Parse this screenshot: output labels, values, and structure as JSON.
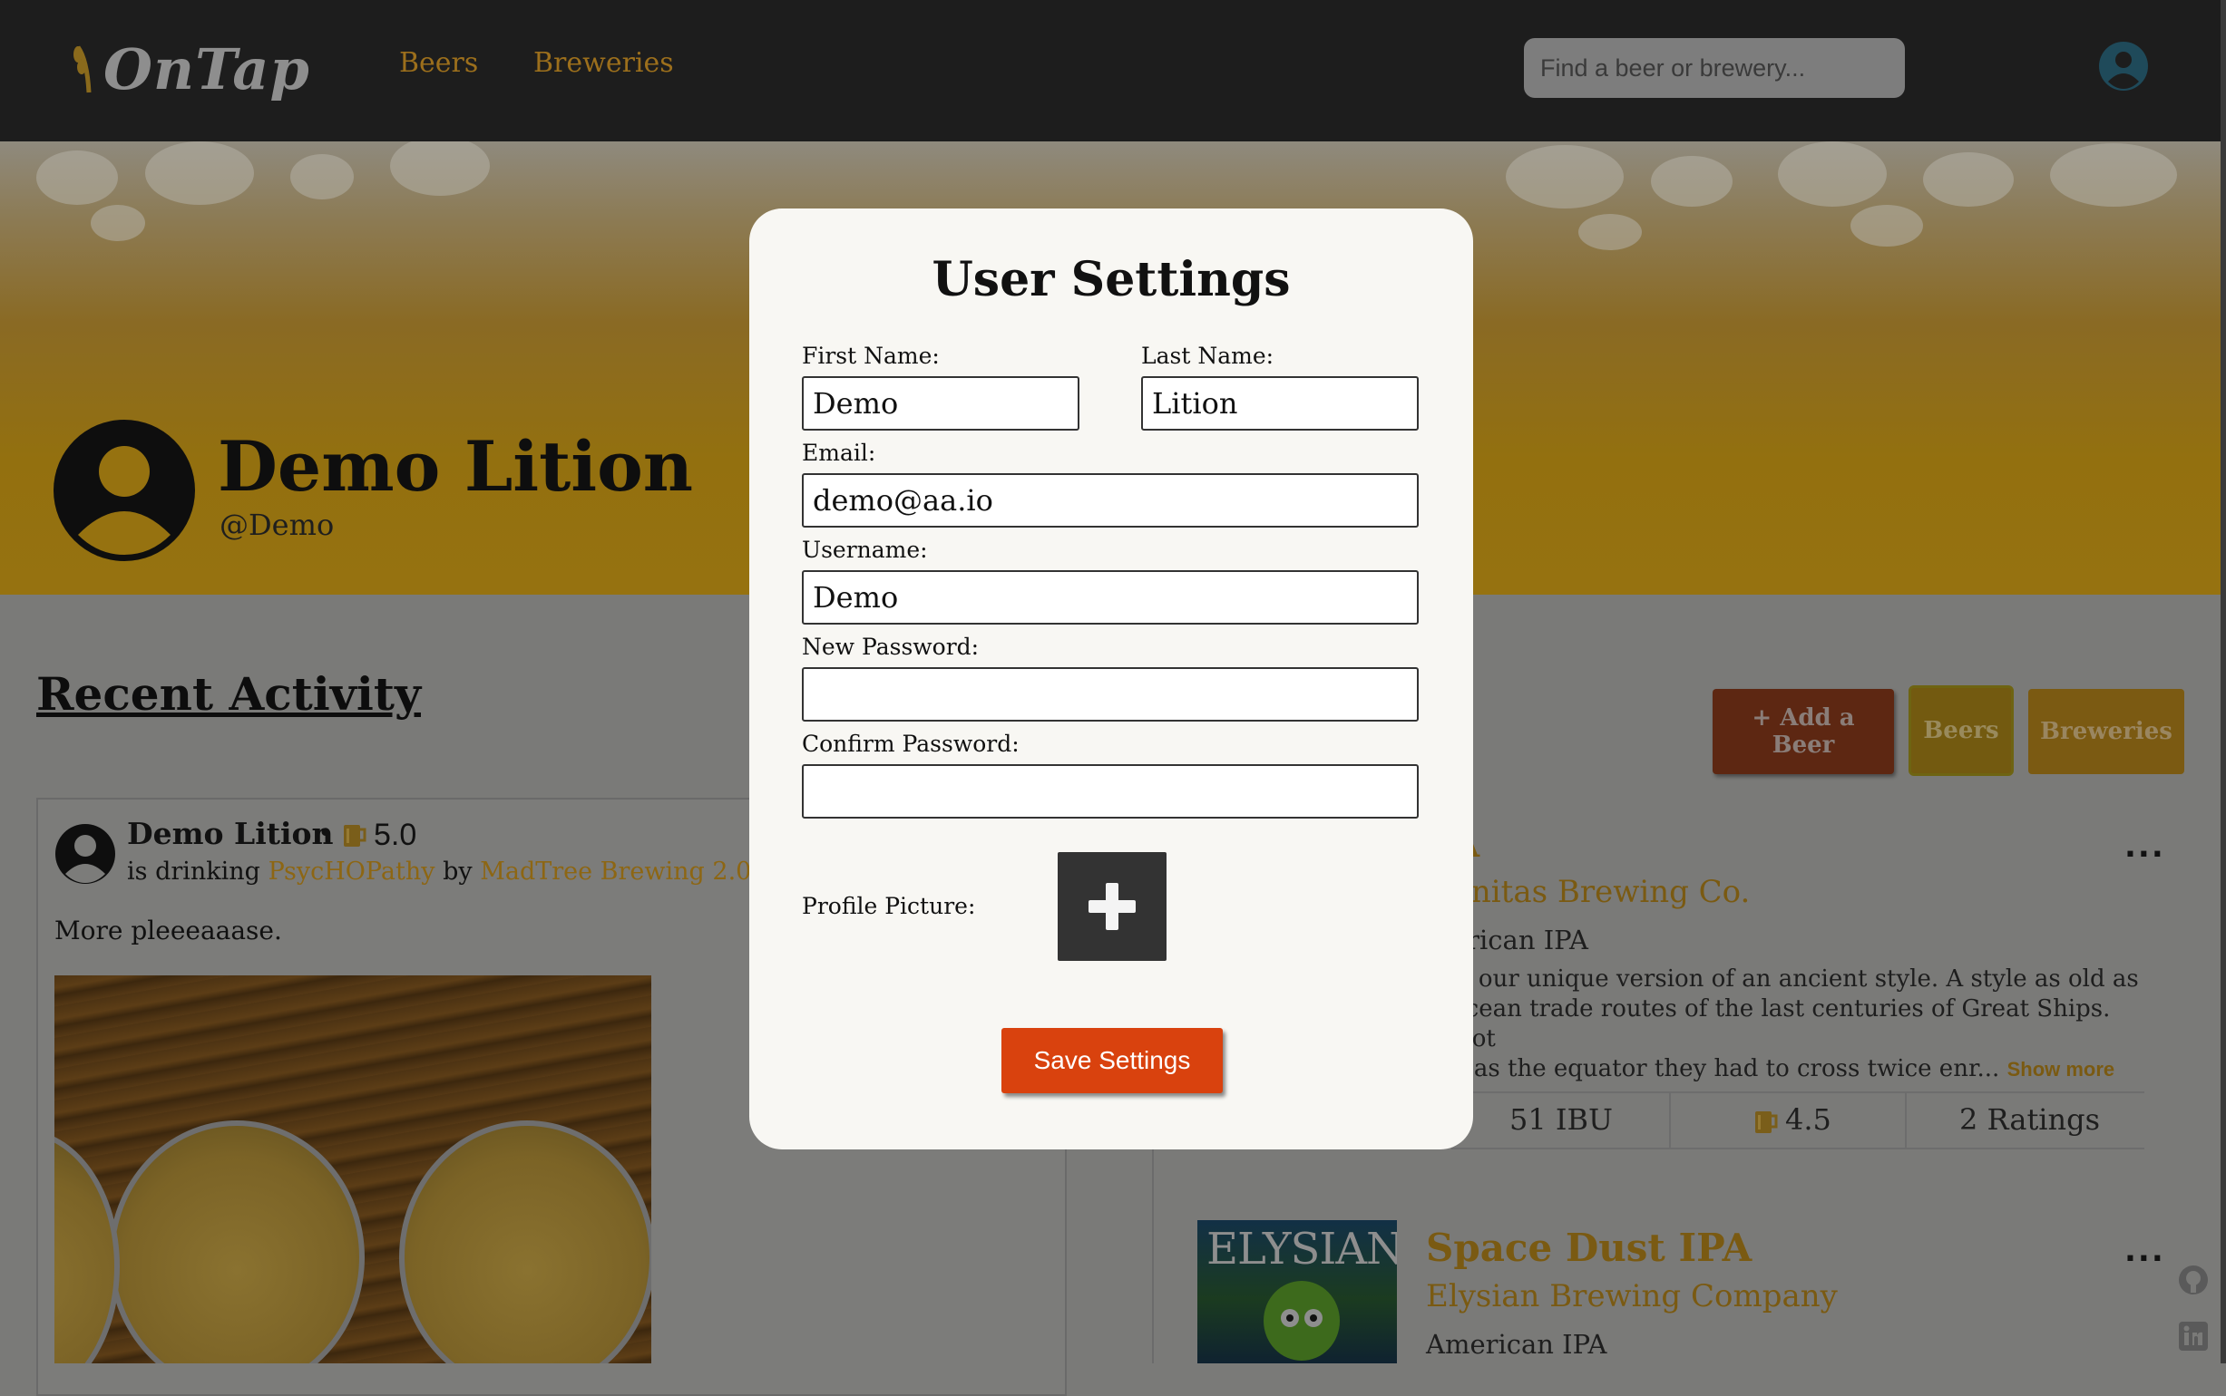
{
  "colors": {
    "accent_gold": "#d59e28",
    "nav_bg": "#1d1d1d",
    "save_button": "#d9420e",
    "modal_bg": "#f8f7f3"
  },
  "nav": {
    "logo": "OnTap",
    "links": [
      "Beers",
      "Breweries"
    ],
    "search_placeholder": "Find a beer or brewery...",
    "account_icon": "user-circle-icon"
  },
  "profile": {
    "name": "Demo Lition",
    "handle": "@Demo"
  },
  "activity": {
    "heading": "Recent Activity",
    "post": {
      "user": "Demo Lition",
      "separator": "•",
      "rating": "5.0",
      "text_prefix": "is drinking",
      "beer": "PsycHOPathy",
      "by": "by",
      "brewery": "MadTree Brewing 2.0",
      "comment": "More pleeeaaase."
    }
  },
  "actions": {
    "add_beer": "+ Add a Beer",
    "beers": "Beers",
    "breweries": "Breweries"
  },
  "beer_list": [
    {
      "name_fragment": "A",
      "brewery_fragment": "unitas Brewing Co.",
      "style_fragment": "erican IPA",
      "desc_lines": [
        "is our unique version of an ancient style. A style as old as",
        "ocean trade routes of the last centuries of Great Ships. Not",
        "d as the equator they had to cross twice enr..."
      ],
      "show_more": "Show more",
      "ibu": "51 IBU",
      "rating": "4.5",
      "ratings_count": "2 Ratings",
      "menu": "..."
    },
    {
      "image_text": "ELYSIAN",
      "name": "Space Dust IPA",
      "brewery": "Elysian Brewing Company",
      "style": "American IPA",
      "menu": "..."
    }
  ],
  "modal": {
    "title": "User Settings",
    "first_name_label": "First Name:",
    "first_name_value": "Demo",
    "last_name_label": "Last Name:",
    "last_name_value": "Lition",
    "email_label": "Email:",
    "email_value": "demo@aa.io",
    "username_label": "Username:",
    "username_value": "Demo",
    "new_password_label": "New Password:",
    "new_password_value": "",
    "confirm_password_label": "Confirm Password:",
    "confirm_password_value": "",
    "profile_picture_label": "Profile Picture:",
    "save_button": "Save Settings"
  }
}
